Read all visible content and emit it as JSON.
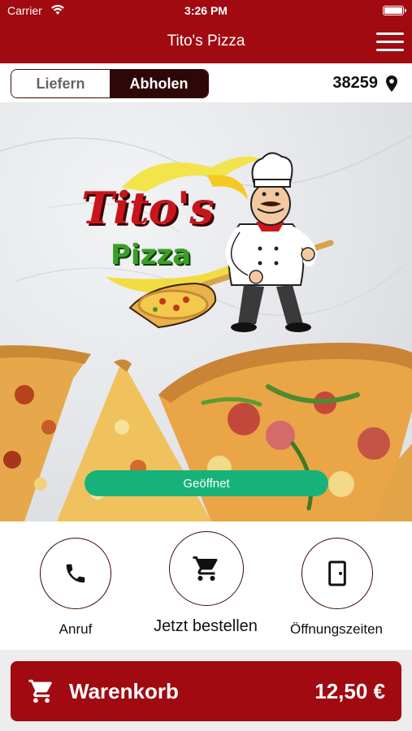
{
  "status_bar": {
    "carrier": "Carrier",
    "time": "3:26 PM"
  },
  "nav": {
    "title": "Tito's Pizza"
  },
  "mode": {
    "deliver_label": "Liefern",
    "pickup_label": "Abholen",
    "selected": "Abholen",
    "zip": "38259"
  },
  "hero": {
    "logo_word1": "Tito's",
    "logo_word2": "Pizza",
    "status_label": "Geöffnet"
  },
  "actions": [
    {
      "label": "Anruf",
      "icon": "phone-icon"
    },
    {
      "label": "Jetzt bestellen",
      "icon": "cart-icon"
    },
    {
      "label": "Öffnungszeiten",
      "icon": "door-icon"
    }
  ],
  "cart": {
    "label": "Warenkorb",
    "total": "12,50 €"
  },
  "colors": {
    "brand": "#a00a10",
    "dark": "#2e0808",
    "open_green": "#17b27a"
  }
}
